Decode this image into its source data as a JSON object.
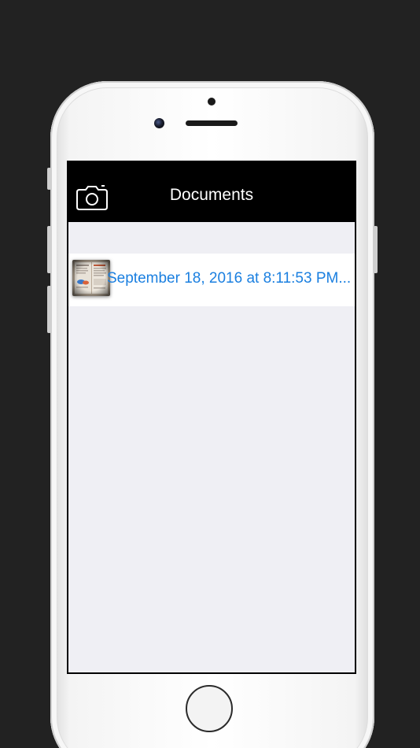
{
  "navbar": {
    "title": "Documents",
    "camera_icon": "camera-icon"
  },
  "documents": [
    {
      "label": "September 18, 2016 at 8:11:53 PM...",
      "thumbnail_icon": "document-thumbnail"
    }
  ],
  "colors": {
    "background": "#222222",
    "navbar": "#000000",
    "content": "#efeff4",
    "row": "#ffffff",
    "link": "#1a7fe0"
  }
}
